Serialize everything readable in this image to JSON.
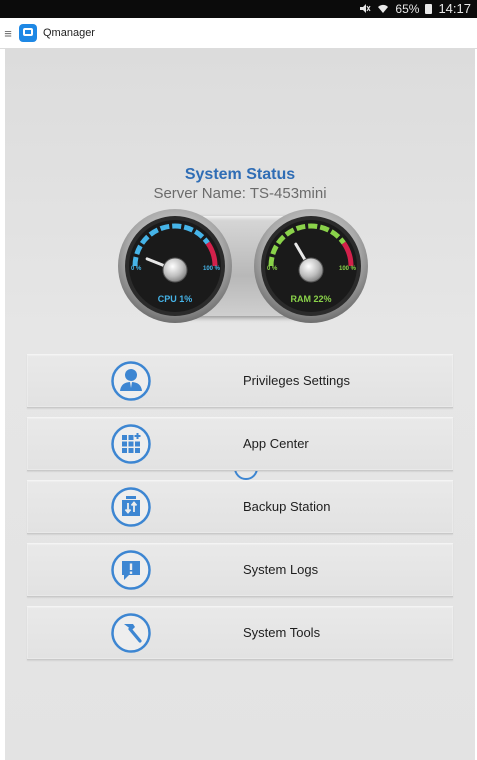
{
  "status_bar": {
    "icons": [
      "mute-icon",
      "wifi-icon"
    ],
    "battery": "65%",
    "time": "14:17"
  },
  "app_bar": {
    "menu_icon": "hamburger-menu-icon",
    "logo_icon": "qmanager-logo-icon",
    "title": "Qmanager"
  },
  "system_status": {
    "title": "System Status",
    "server_name": "Server Name: TS-453mini",
    "cpu": {
      "caption": "CPU 1%",
      "usage_percent": 1,
      "min_label": "0 %",
      "max_label": "100 %",
      "accent_color": "#46b4e8"
    },
    "ram": {
      "caption": "RAM 22%",
      "usage_percent": 22,
      "min_label": "0 %",
      "max_label": "100 %",
      "accent_color": "#8ad24a"
    },
    "center_icon": "speedometer-icon"
  },
  "menu": {
    "items": [
      {
        "label": "Privileges Settings",
        "icon": "user-icon"
      },
      {
        "label": "App Center",
        "icon": "app-grid-icon"
      },
      {
        "label": "Backup Station",
        "icon": "backup-icon"
      },
      {
        "label": "System Logs",
        "icon": "alert-message-icon"
      },
      {
        "label": "System Tools",
        "icon": "hammer-icon"
      }
    ]
  },
  "colors": {
    "accent_blue": "#2f6db5",
    "icon_blue": "#3d86d2",
    "danger_red": "#d3214b"
  }
}
